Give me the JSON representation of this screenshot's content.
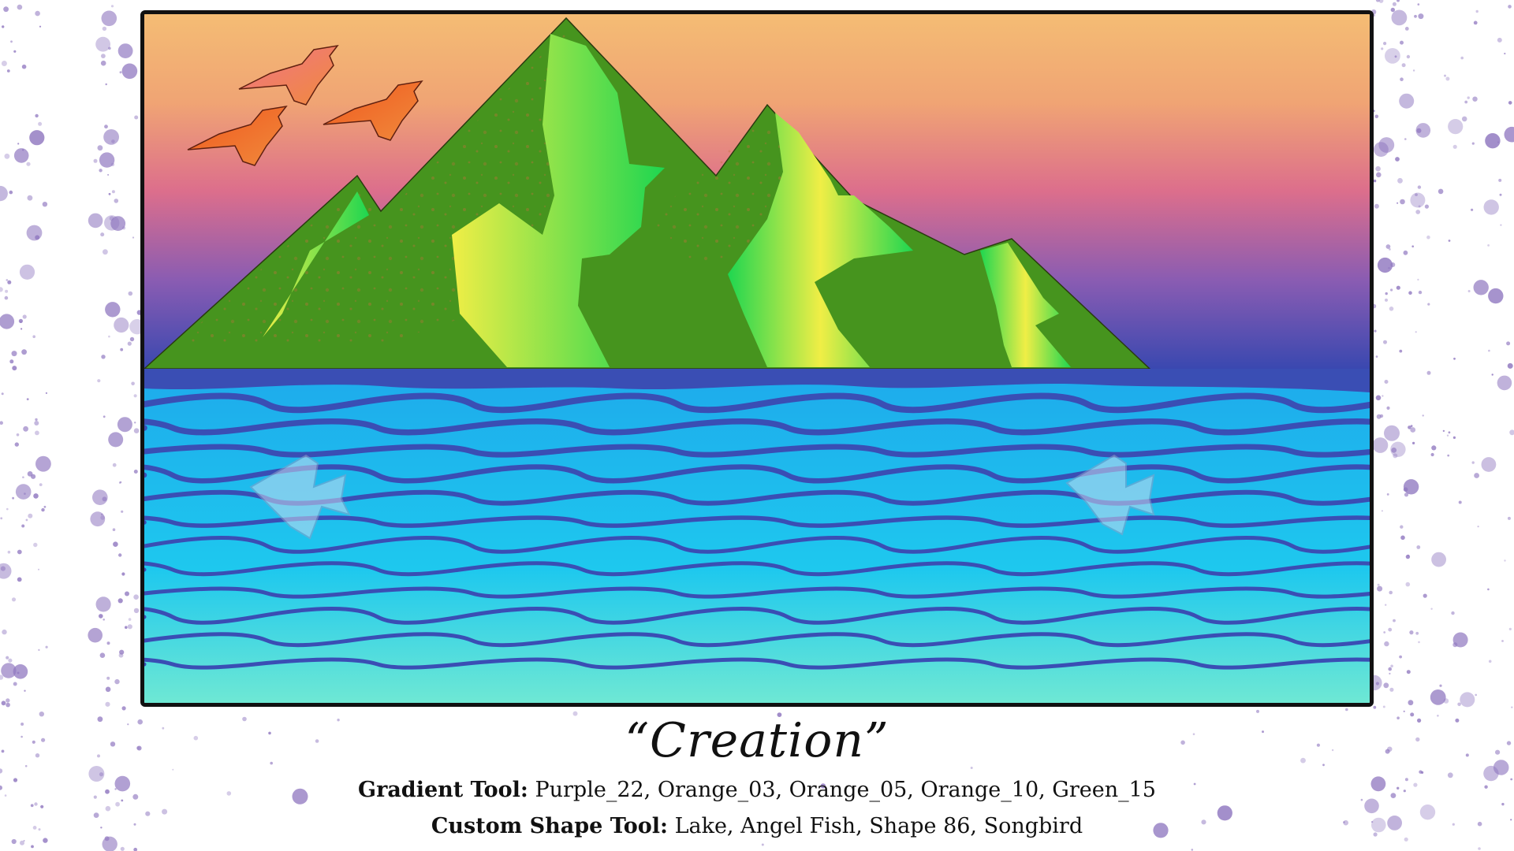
{
  "title": "Creation",
  "title_quote_open": "“",
  "title_quote_close": "”",
  "caption_lines": [
    {
      "label": "Gradient Tool:",
      "value": "Purple_22, Orange_03, Orange_05, Orange_10, Green_15"
    },
    {
      "label": "Custom Shape Tool:",
      "value": "Lake, Angel Fish, Shape 86, Songbird"
    }
  ],
  "artwork": {
    "sky_colors": [
      "#f4bc74",
      "#f0a474",
      "#dc6e8c",
      "#8a5cb2",
      "#3a48b0"
    ],
    "mountain_color": "#46941e",
    "mountain_highlight_colors": [
      "#1ed650",
      "#f0ee46"
    ],
    "water_colors": [
      "#3a4eb4",
      "#1eaaec",
      "#1ec8ee",
      "#6ee8d4"
    ],
    "bird_colors": [
      "#f07488",
      "#f08a3c",
      "#f0581e"
    ],
    "fish_color": "#c8dcf0",
    "splatter_color": "#9078c0"
  }
}
